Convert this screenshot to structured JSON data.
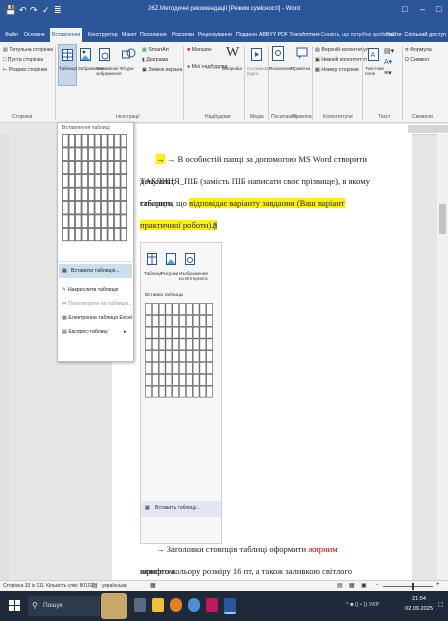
{
  "titlebar": {
    "title": "26Z.Методичні рекомендації [Режим сумісності] - Word",
    "qat": [
      "💾",
      "↶",
      "↷",
      "✓",
      "≣"
    ],
    "window_buttons": [
      "□",
      "–",
      "□"
    ]
  },
  "tabs": [
    "Файл",
    "Основне",
    "Вставлення",
    "Конструктор",
    "Макет",
    "Посилання",
    "Розсилки",
    "Рецензування",
    "Подання",
    "ABBYY PDF Transformer+"
  ],
  "active_tab": "Вставлення",
  "tell_me": "Скажіть, що потрібно зробити...",
  "account": "Увійти",
  "share": "Спільний доступ",
  "ribbon": {
    "pages": [
      "Титульна сторінка",
      "Пуста сторінка",
      "Розрив сторінки"
    ],
    "pages_group": "Сторінки",
    "table_btn": "Таблиця",
    "illus": [
      "Зображення",
      "Онлайнові зображення",
      "Фігури"
    ],
    "smartart": [
      "SmartArt",
      "Діаграма",
      "Знімок екрана"
    ],
    "illus_group": "Ілюстрації",
    "store": "Магазин",
    "myaddins": "Мої надбудови",
    "wiki": "Wikipedia",
    "addins_group": "Надбудови",
    "media": "Онлайнове відео",
    "media_group": "Медіа",
    "links": "Посилання",
    "comment": "Примітка",
    "comments_group": "Примітки",
    "header": "Верхній колонтитул",
    "footer": "Нижній колонтитул",
    "pagenum": "Номер сторінки",
    "hf_group": "Колонтитули",
    "textbox": "Текстове поле",
    "text_group": "Текст",
    "formula": "Формула",
    "symbol": "Символ",
    "symbols_group": "Символи"
  },
  "dropdown": {
    "title": "Вставлення таблиці",
    "items": [
      "Вставити таблицю...",
      "Накреслити таблицю",
      "Перетворити на таблицю...",
      "Електронна таблиця Excel",
      "Експрес-таблиці"
    ]
  },
  "document": {
    "line1": "→ В особистій папці за допомогою MS Word створити документ",
    "line2": "ТАБЛИЦЯ_ПІБ (замість ПІБ написати своє прізвище), в якому створити",
    "line3a": "таблицю, що ",
    "line3b": "відповідає варіанту завдання (Ваш варіант можна знайти в кінці",
    "line4": "практичної роботи).",
    "mark": "¶",
    "inner_buttons": [
      "Таблиця",
      "Рисунки",
      "Изображения из Интернета",
      "Фі"
    ],
    "inner_title": "Вставка таблицы",
    "inner_item": "Вставить таблицу...",
    "line5a": "→ Заголовки стовпців таблиці оформити ",
    "line5b": "жирним",
    "line5c": " шрифтом",
    "line6": "жовтого кольору розміру 16 пт, а також заливкою світлого кольору.",
    "bold_color": "#c00000"
  },
  "status": {
    "page": "Сторінка 33 із 111",
    "words": "Кількість слів: 80102",
    "lang": "українська",
    "zoom": "-"
  },
  "taskbar": {
    "search": "Пошук",
    "tray": "^  ■  (( • ))  УКР",
    "time": "21:54",
    "date": "02.09.2025"
  },
  "colors": {
    "word_blue": "#2b579a",
    "highlight": "#fff200",
    "taskbar": "#1e2a3a"
  }
}
